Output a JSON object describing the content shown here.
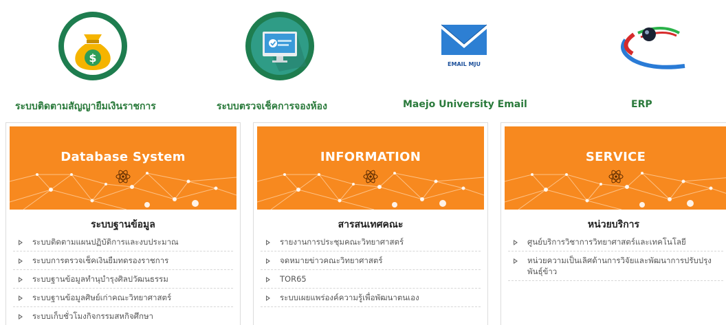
{
  "top_links": [
    {
      "title": "ระบบติดตามสัญญายืมเงินราชการ",
      "icon": "money-bag-icon"
    },
    {
      "title": "ระบบตรวจเช็คการจองห้อง",
      "icon": "monitor-check-icon"
    },
    {
      "title": "Maejo University Email",
      "icon": "email-mju-icon",
      "icon_text": "EMAIL MJU"
    },
    {
      "title": "ERP",
      "icon": "erp-logo-icon"
    }
  ],
  "cards": [
    {
      "banner": "Database System",
      "heading": "ระบบฐานข้อมูล",
      "items": [
        "ระบบติดตามแผนปฏิบัติการและงบประมาณ",
        "ระบบการตรวจเช็คเงินยืมทดรองราชการ",
        "ระบบฐานข้อมูลทำนุบำรุงศิลปวัฒนธรรม",
        "ระบบฐานข้อมูลศิษย์เก่าคณะวิทยาศาสตร์",
        "ระบบเก็บชั่วโมงกิจกรรมสหกิจศึกษา"
      ]
    },
    {
      "banner": "INFORMATION",
      "heading": "สารสนเทศคณะ",
      "items": [
        "รายงานการประชุมคณะวิทยาศาสตร์",
        "จดหมายข่าวคณะวิทยาศาสตร์",
        "TOR65",
        "ระบบเผยแพร่องค์ความรู้เพื่อพัฒนาตนเอง"
      ]
    },
    {
      "banner": "SERVICE",
      "heading": "หน่วยบริการ",
      "items": [
        "ศูนย์บริการวิชาการวิทยาศาสตร์และเทคโนโลยี",
        "หน่วยความเป็นเลิศด้านการวิจัยและพัฒนาการปรับปรุงพันธุ์ข้าว"
      ]
    }
  ],
  "colors": {
    "green_title": "#2a7a3b",
    "banner_orange": "#f7891f",
    "icon_ring": "#1e7d4f"
  }
}
